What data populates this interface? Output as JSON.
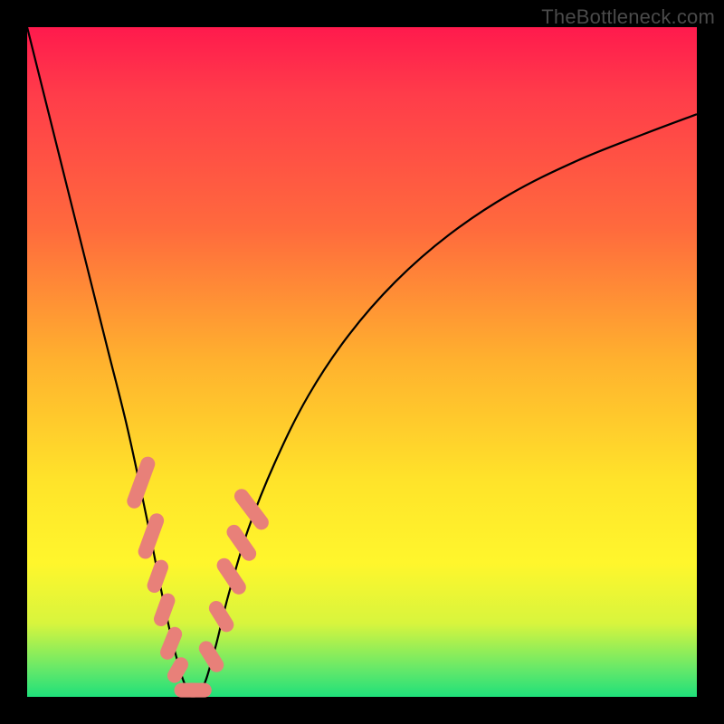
{
  "watermark": "TheBottleneck.com",
  "colors": {
    "frame": "#000000",
    "gradient_top": "#ff1a4d",
    "gradient_mid1": "#ff6a3d",
    "gradient_mid2": "#ffe42a",
    "gradient_bottom": "#1fe07a",
    "curve": "#000000",
    "markers": "#e88079"
  },
  "chart_data": {
    "type": "line",
    "title": "",
    "xlabel": "",
    "ylabel": "",
    "xlim": [
      0,
      100
    ],
    "ylim": [
      0,
      100
    ],
    "series": [
      {
        "name": "bottleneck-curve",
        "description": "V-shaped bottleneck percentage curve: steep drop from top-left to a minimum near x≈24, then a decelerating rise toward the upper right.",
        "x": [
          0,
          3,
          6,
          9,
          12,
          15,
          18,
          20,
          22,
          24,
          26,
          28,
          30,
          33,
          37,
          42,
          48,
          55,
          63,
          72,
          82,
          92,
          100
        ],
        "y": [
          100,
          88,
          76,
          64,
          52,
          40,
          26,
          16,
          7,
          1,
          1,
          7,
          15,
          25,
          35,
          45,
          54,
          62,
          69,
          75,
          80,
          84,
          87
        ]
      }
    ],
    "markers": {
      "description": "Pink capsule-shaped data point clusters laid along the lower V region of the curve.",
      "shape": "capsule",
      "points": [
        {
          "x": 17,
          "y": 32,
          "len": 7,
          "angle": -70
        },
        {
          "x": 18.5,
          "y": 24,
          "len": 6,
          "angle": -70
        },
        {
          "x": 19.5,
          "y": 18,
          "len": 4,
          "angle": -70
        },
        {
          "x": 20.5,
          "y": 13,
          "len": 4,
          "angle": -70
        },
        {
          "x": 21.5,
          "y": 8,
          "len": 4,
          "angle": -68
        },
        {
          "x": 22.5,
          "y": 4,
          "len": 3,
          "angle": -60
        },
        {
          "x": 24,
          "y": 1,
          "len": 3,
          "angle": 0
        },
        {
          "x": 25.5,
          "y": 1,
          "len": 3,
          "angle": 0
        },
        {
          "x": 27.5,
          "y": 6,
          "len": 4,
          "angle": 58
        },
        {
          "x": 29,
          "y": 12,
          "len": 4,
          "angle": 58
        },
        {
          "x": 30.5,
          "y": 18,
          "len": 5,
          "angle": 56
        },
        {
          "x": 32,
          "y": 23,
          "len": 5,
          "angle": 55
        },
        {
          "x": 33.5,
          "y": 28,
          "len": 6,
          "angle": 53
        }
      ]
    }
  }
}
